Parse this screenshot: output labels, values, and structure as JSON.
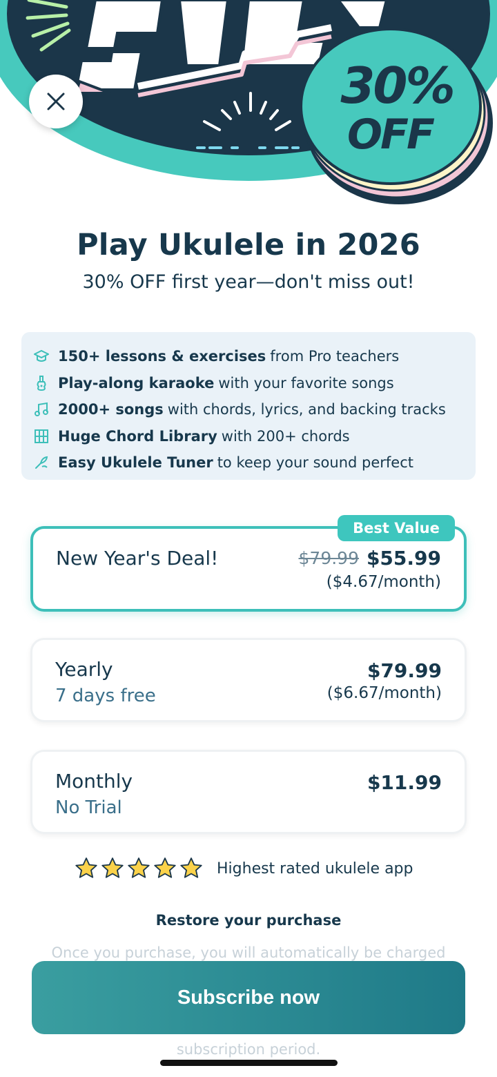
{
  "hero": {
    "banner_text": "SALE",
    "discount_percent": "30%",
    "discount_word": "OFF"
  },
  "header": {
    "title": "Play Ukulele in 2026",
    "subtitle": "30% OFF first year—don't miss out!"
  },
  "features": [
    {
      "icon": "graduation-cap-icon",
      "bold": "150+ lessons & exercises",
      "rest": "from Pro teachers"
    },
    {
      "icon": "ukulele-icon",
      "bold": "Play-along karaoke",
      "rest": "with your favorite songs"
    },
    {
      "icon": "music-note-icon",
      "bold": "2000+ songs",
      "rest": "with chords, lyrics, and backing tracks"
    },
    {
      "icon": "chord-grid-icon",
      "bold": "Huge Chord Library",
      "rest": "with 200+ chords"
    },
    {
      "icon": "tuner-icon",
      "bold": "Easy Ukulele Tuner",
      "rest": "to keep your sound perfect"
    }
  ],
  "plans": {
    "best": {
      "badge": "Best Value",
      "name": "New Year's Deal!",
      "old_price": "$79.99",
      "price": "$55.99",
      "per_month": "($4.67/month)"
    },
    "yearly": {
      "name": "Yearly",
      "sub": "7 days free",
      "price": "$79.99",
      "per_month": "($6.67/month)"
    },
    "monthly": {
      "name": "Monthly",
      "sub": "No Trial",
      "price": "$11.99"
    }
  },
  "rating": {
    "stars": 5,
    "text": "Highest rated ukulele app"
  },
  "restore_label": "Restore your purchase",
  "legal": {
    "line1": "Once you purchase, you will automatically be charged",
    "line2": "subscription period."
  },
  "cta": {
    "subscribe_label": "Subscribe now"
  },
  "colors": {
    "accent": "#3dbfb9",
    "dark_navy": "#17384c",
    "cta_start": "#3a9ea0",
    "cta_end": "#1f7a88"
  }
}
